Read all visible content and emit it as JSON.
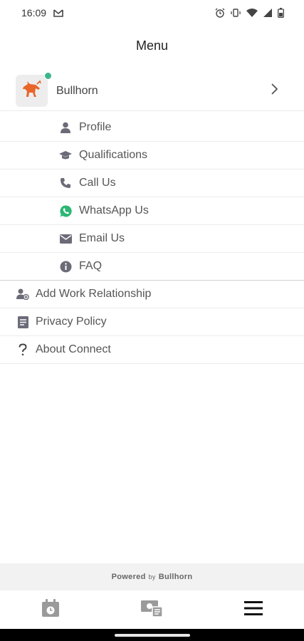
{
  "status_bar": {
    "time": "16:09",
    "icons": [
      "gmail-icon",
      "alarm-icon",
      "vibrate-icon",
      "wifi-icon",
      "signal-icon",
      "battery-icon"
    ]
  },
  "header": {
    "title": "Menu"
  },
  "account": {
    "name": "Bullhorn",
    "online": true,
    "logo_icon": "bullhorn-logo-icon"
  },
  "sub_items": [
    {
      "label": "Profile",
      "icon": "person-icon"
    },
    {
      "label": "Qualifications",
      "icon": "graduation-cap-icon"
    },
    {
      "label": "Call Us",
      "icon": "phone-icon"
    },
    {
      "label": "WhatsApp Us",
      "icon": "whatsapp-icon"
    },
    {
      "label": "Email Us",
      "icon": "envelope-icon"
    },
    {
      "label": "FAQ",
      "icon": "info-icon"
    }
  ],
  "top_items": [
    {
      "label": "Add Work Relationship",
      "icon": "person-add-icon"
    },
    {
      "label": "Privacy Policy",
      "icon": "document-icon"
    },
    {
      "label": "About Connect",
      "icon": "question-icon"
    }
  ],
  "footer": {
    "powered": "Powered",
    "by": "by",
    "brand": "Bullhorn"
  },
  "tabbar": {
    "tabs": [
      "calendar-icon",
      "money-icon",
      "menu-icon"
    ],
    "active": "menu-icon"
  },
  "colors": {
    "accent_green": "#3db68a",
    "whatsapp_green": "#2bb673",
    "logo_orange": "#e8662a",
    "icon_gray": "#6b6b78"
  }
}
